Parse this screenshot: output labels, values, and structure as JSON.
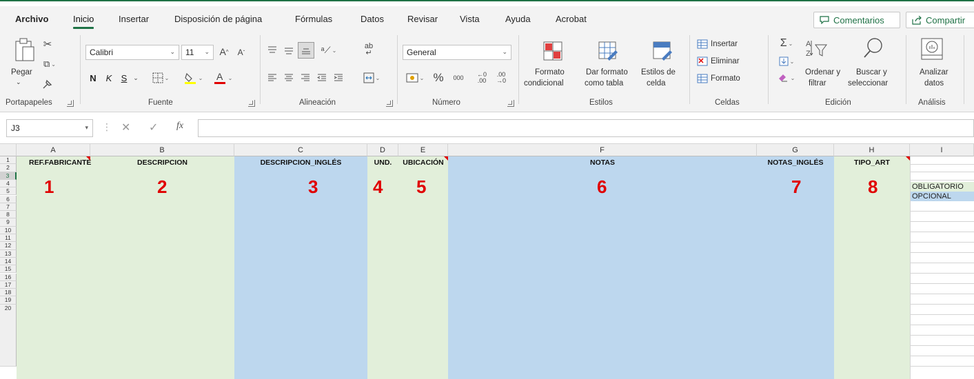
{
  "tabs": [
    "Archivo",
    "Inicio",
    "Insertar",
    "Disposición de página",
    "Fórmulas",
    "Datos",
    "Revisar",
    "Vista",
    "Ayuda",
    "Acrobat"
  ],
  "comments_label": "Comentarios",
  "share_label": "Compartir",
  "clipboard": {
    "paste_label": "Pegar",
    "group_label": "Portapapeles"
  },
  "font": {
    "name": "Calibri",
    "size": "11",
    "bold": "N",
    "italic": "K",
    "underline": "S",
    "group_label": "Fuente"
  },
  "alignment": {
    "group_label": "Alineación"
  },
  "number": {
    "format": "General",
    "percent": "%",
    "thousands": "000",
    "group_label": "Número"
  },
  "styles": {
    "cond_format_l1": "Formato",
    "cond_format_l2": "condicional",
    "as_table_l1": "Dar formato",
    "as_table_l2": "como tabla",
    "cell_styles_l1": "Estilos de",
    "cell_styles_l2": "celda",
    "group_label": "Estilos"
  },
  "cells": {
    "insert": "Insertar",
    "delete": "Eliminar",
    "format": "Formato",
    "group_label": "Celdas"
  },
  "editing": {
    "sort_l1": "Ordenar y",
    "sort_l2": "filtrar",
    "find_l1": "Buscar y",
    "find_l2": "seleccionar",
    "group_label": "Edición"
  },
  "analysis": {
    "analyze_l1": "Analizar",
    "analyze_l2": "datos",
    "group_label": "Análisis"
  },
  "formula_bar": {
    "name_box": "J3",
    "fx": "fx",
    "formula": ""
  },
  "columns": [
    "A",
    "B",
    "C",
    "D",
    "E",
    "F",
    "G",
    "H",
    "I"
  ],
  "rows": [
    "1",
    "2",
    "3",
    "4",
    "5",
    "6",
    "7",
    "8",
    "9",
    "10",
    "11",
    "12",
    "13",
    "14",
    "15",
    "16",
    "17",
    "18",
    "19",
    "20"
  ],
  "headers": [
    "REF.FABRICANTE",
    "DESCRIPCION",
    "DESCRIPCION_INGLÉS",
    "UND.",
    "UBICACIÓN",
    "NOTAS",
    "NOTAS_INGLÉS",
    "TIPO_ART"
  ],
  "markers": [
    "1",
    "2",
    "3",
    "4",
    "5",
    "6",
    "7",
    "8"
  ],
  "validation_list": [
    "OBLIGATORIO",
    "OPCIONAL"
  ],
  "colors": {
    "green_fill": "#e2efda",
    "blue_fill": "#bdd7ee",
    "marker_red": "#e00000",
    "excel_green": "#1f7246"
  }
}
